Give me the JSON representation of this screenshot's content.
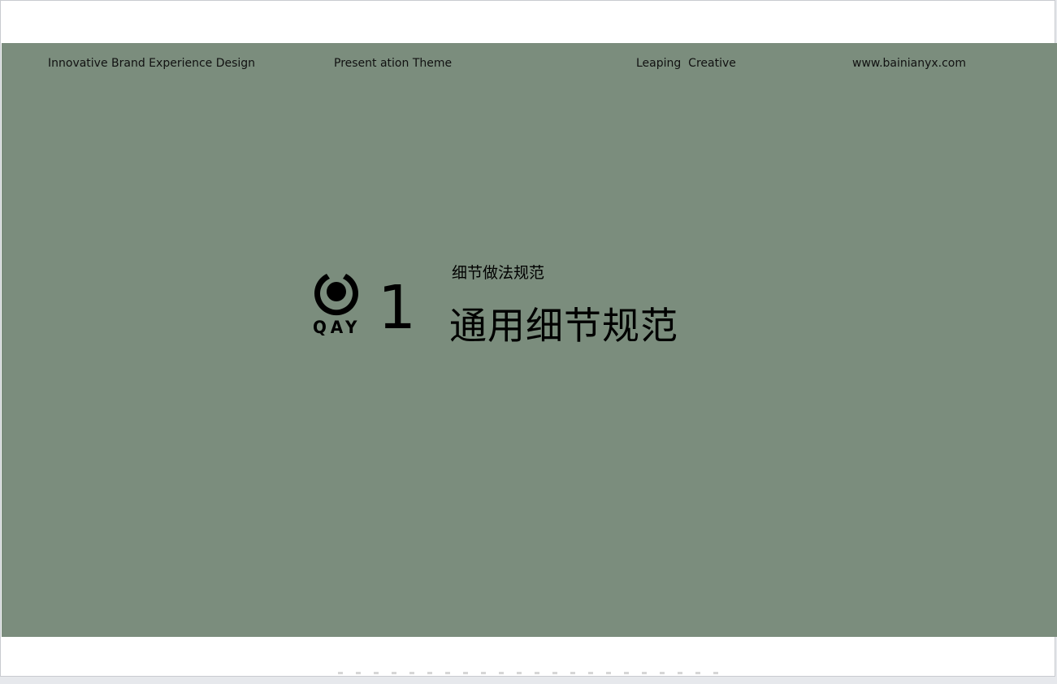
{
  "header": {
    "left": "Innovative Brand Experience Design",
    "center_left": "Present ation Theme",
    "center_right": "Leaping  Creative",
    "right": "www.bainianyx.com"
  },
  "logo": {
    "text": "QAY",
    "icon": "qay-logo-icon"
  },
  "section": {
    "number": "1",
    "subtitle": "细节做法规范",
    "title": "通用细节规范"
  },
  "colors": {
    "slide_background": "#7b8d7d",
    "page_background": "#ffffff",
    "text": "#000000"
  }
}
